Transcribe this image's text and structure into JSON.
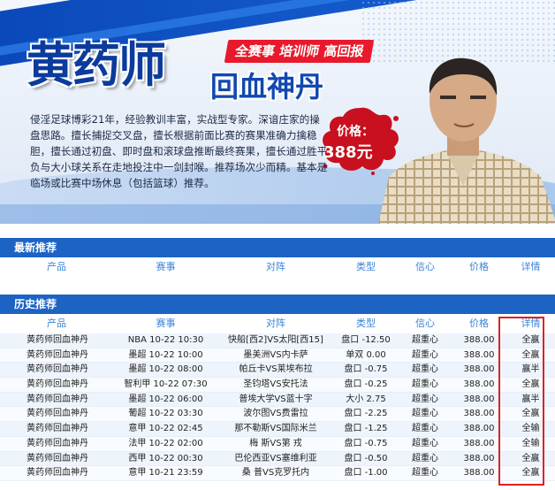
{
  "banner": {
    "title_main": "黄药师",
    "title_sub": "回血神丹",
    "tagline": "全赛事 培训师 高回报",
    "price_label": "价格：",
    "price_value": "388元",
    "description": "侵淫足球博彩21年，经验教训丰富，实战型专家。深谙庄家的操盘思路。擅长捕捉交叉盘，擅长根据前面比赛的赛果准确力擒稳胆，擅长通过初盘、即时盘和滚球盘推断最终赛果，擅长通过胜平负与大小球关系在走地投注中一剑封喉。推荐场次少而精。基本是临场或比赛中场休息（包括篮球）推荐。",
    "colors": {
      "brand_blue": "#0b3b9c",
      "accent_red": "#e8192c"
    }
  },
  "latest": {
    "heading": "最新推荐",
    "columns": [
      "产品",
      "赛事",
      "对阵",
      "类型",
      "信心",
      "价格",
      "详情"
    ]
  },
  "history": {
    "heading": "历史推荐",
    "columns": [
      "产品",
      "赛事",
      "对阵",
      "类型",
      "信心",
      "价格",
      "详情"
    ],
    "rows": [
      {
        "product": "黄药师回血神丹",
        "event": "NBA 10-22 10:30",
        "match": "快船[西2]VS太阳[西15]",
        "type": "盘口 -12.50",
        "confidence": "超重心",
        "price": "388.00",
        "detail": "全赢"
      },
      {
        "product": "黄药师回血神丹",
        "event": "墨超 10-22 10:00",
        "match": "墨美洲VS内卡萨",
        "type": "单双 0.00",
        "confidence": "超重心",
        "price": "388.00",
        "detail": "全赢"
      },
      {
        "product": "黄药师回血神丹",
        "event": "墨超 10-22 08:00",
        "match": "帕丘卡VS莱埃布拉",
        "type": "盘口 -0.75",
        "confidence": "超重心",
        "price": "388.00",
        "detail": "赢半"
      },
      {
        "product": "黄药师回血神丹",
        "event": "智利甲 10-22 07:30",
        "match": "圣钧塔VS安托法",
        "type": "盘口 -0.25",
        "confidence": "超重心",
        "price": "388.00",
        "detail": "全赢"
      },
      {
        "product": "黄药师回血神丹",
        "event": "墨超 10-22 06:00",
        "match": "普埃大学VS蓝十字",
        "type": "大小 2.75",
        "confidence": "超重心",
        "price": "388.00",
        "detail": "赢半"
      },
      {
        "product": "黄药师回血神丹",
        "event": "葡超 10-22 03:30",
        "match": "波尔图VS费雷拉",
        "type": "盘口 -2.25",
        "confidence": "超重心",
        "price": "388.00",
        "detail": "全赢"
      },
      {
        "product": "黄药师回血神丹",
        "event": "意甲 10-22 02:45",
        "match": "那不勒斯VS国际米兰",
        "type": "盘口 -1.25",
        "confidence": "超重心",
        "price": "388.00",
        "detail": "全输"
      },
      {
        "product": "黄药师回血神丹",
        "event": "法甲 10-22 02:00",
        "match": "梅 斯VS第 戎",
        "type": "盘口 -0.75",
        "confidence": "超重心",
        "price": "388.00",
        "detail": "全输"
      },
      {
        "product": "黄药师回血神丹",
        "event": "西甲 10-22 00:30",
        "match": "巴伦西亚VS塞维利亚",
        "type": "盘口 -0.50",
        "confidence": "超重心",
        "price": "388.00",
        "detail": "全赢"
      },
      {
        "product": "黄药师回血神丹",
        "event": "意甲 10-21 23:59",
        "match": "桑 普VS克罗托内",
        "type": "盘口 -1.00",
        "confidence": "超重心",
        "price": "388.00",
        "detail": "全赢"
      }
    ]
  }
}
